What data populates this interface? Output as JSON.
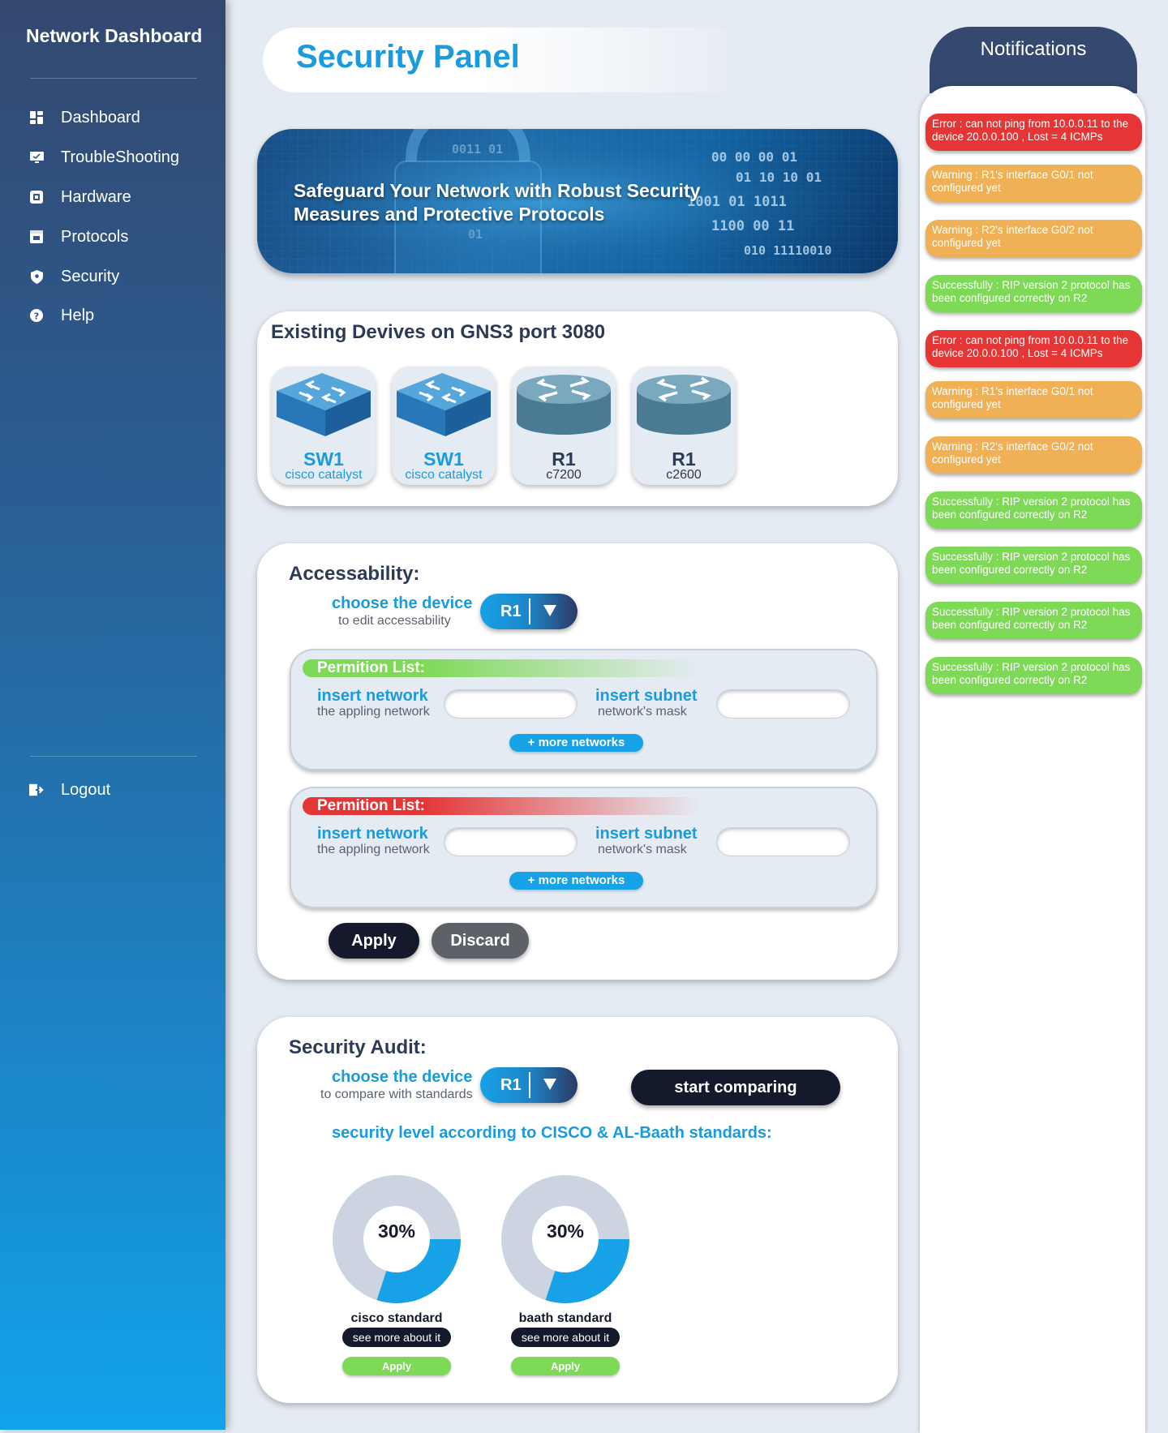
{
  "sidebar": {
    "brand": "Network Dashboard",
    "items": [
      {
        "label": "Dashboard",
        "icon": "dashboard-icon"
      },
      {
        "label": "TroubleShooting",
        "icon": "monitor-icon"
      },
      {
        "label": "Hardware",
        "icon": "chip-icon"
      },
      {
        "label": "Protocols",
        "icon": "protocol-icon"
      },
      {
        "label": "Security",
        "icon": "shield-icon"
      },
      {
        "label": "Help",
        "icon": "help-icon"
      }
    ],
    "logout": {
      "label": "Logout",
      "icon": "logout-icon"
    }
  },
  "header": {
    "title": "Security Panel"
  },
  "banner": {
    "text": "Safeguard Your Network with Robust Security Measures and Protective Protocols"
  },
  "devices": {
    "title": "Existing Devives on GNS3 port 3080",
    "items": [
      {
        "name": "SW1",
        "model": "cisco catalyst",
        "type": "switch"
      },
      {
        "name": "SW1",
        "model": "cisco catalyst",
        "type": "switch"
      },
      {
        "name": "R1",
        "model": "c7200",
        "type": "router"
      },
      {
        "name": "R1",
        "model": "c2600",
        "type": "router"
      }
    ]
  },
  "accessability": {
    "title": "Accessability:",
    "choose_label": "choose the device",
    "choose_sub": "to edit accessability",
    "selected_device": "R1",
    "lists": [
      {
        "header": "Permition List:",
        "network_label": "insert network",
        "network_sub": "the appling network",
        "network_value": "",
        "subnet_label": "insert subnet",
        "subnet_sub": "network's mask",
        "subnet_value": "",
        "more": "+ more networks"
      },
      {
        "header": "Permition List:",
        "network_label": "insert network",
        "network_sub": "the appling network",
        "network_value": "",
        "subnet_label": "insert subnet",
        "subnet_sub": "network's mask",
        "subnet_value": "",
        "more": "+ more networks"
      }
    ],
    "apply": "Apply",
    "discard": "Discard"
  },
  "audit": {
    "title": "Security Audit:",
    "choose_label": "choose the device",
    "choose_sub": "to compare with standards",
    "selected_device": "R1",
    "start": "start comparing",
    "level_title": "security level according to CISCO & AL-Baath standards:",
    "gauges": [
      {
        "percent_label": "30%",
        "value": 0.3,
        "label": "cisco standard",
        "more": "see more about it",
        "apply": "Apply"
      },
      {
        "percent_label": "30%",
        "value": 0.3,
        "label": "baath standard",
        "more": "see more about it",
        "apply": "Apply"
      }
    ]
  },
  "notifications": {
    "title": "Notifications",
    "items": [
      {
        "type": "error",
        "text": "Error : can not ping from 10.0.0.11 to the device 20.0.0.100 , Lost = 4 ICMPs"
      },
      {
        "type": "warning",
        "text": "Warning : R1's interface G0/1 not configured yet"
      },
      {
        "type": "warning",
        "text": "Warning : R2's interface G0/2 not configured yet"
      },
      {
        "type": "success",
        "text": "Successfully : RIP version 2 protocol has been configured correctly on R2"
      },
      {
        "type": "error",
        "text": "Error : can not ping from 10.0.0.11 to the device 20.0.0.100 , Lost = 4 ICMPs"
      },
      {
        "type": "warning",
        "text": "Warning : R1's interface G0/1 not configured yet"
      },
      {
        "type": "warning",
        "text": "Warning : R2's interface G0/2 not configured yet"
      },
      {
        "type": "success",
        "text": "Successfully : RIP version 2 protocol has been configured correctly on R2"
      },
      {
        "type": "success",
        "text": "Successfully : RIP version 2 protocol has been configured correctly on R2"
      },
      {
        "type": "success",
        "text": "Successfully : RIP version 2 protocol has been configured correctly on R2"
      },
      {
        "type": "success",
        "text": "Successfully : RIP version 2 protocol has been configured correctly on R2"
      }
    ]
  },
  "colors": {
    "accent": "#1a9bde",
    "dark": "#141a2b",
    "error": "#e53535",
    "warning": "#f0b055",
    "success": "#7ed957",
    "gauge_fill": "#17a1e6",
    "gauge_track": "#cbd4e0"
  }
}
